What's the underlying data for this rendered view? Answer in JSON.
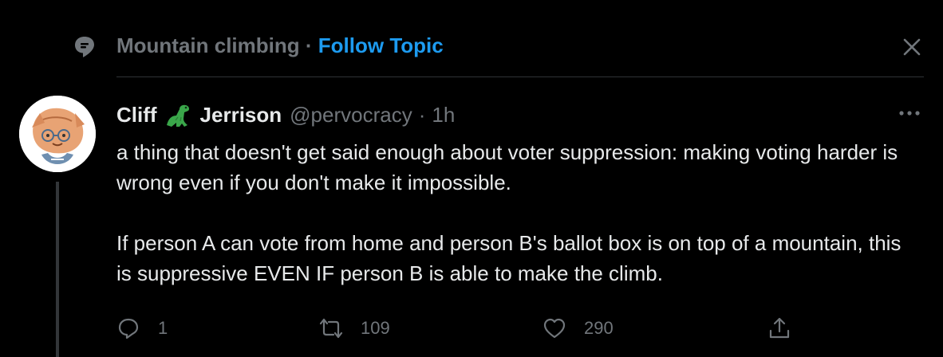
{
  "topic": {
    "name": "Mountain climbing",
    "separator": "·",
    "follow_label": "Follow Topic"
  },
  "tweet": {
    "author_first": "Cliff",
    "author_last": "Jerrison",
    "handle": "@pervocracy",
    "separator": "·",
    "time": "1h",
    "paragraphs": [
      "a thing that doesn't get said enough about voter suppression: making voting harder is wrong even if you don't make it impossible.",
      "If person A can vote from home and person B's ballot box is on top of a mountain, this is suppressive EVEN IF person B is able to make the climb."
    ],
    "reply_count": "1",
    "retweet_count": "109",
    "like_count": "290"
  },
  "icons": {
    "topic": "topic-icon",
    "close": "close-icon",
    "more": "more-icon",
    "reply": "reply-icon",
    "retweet": "retweet-icon",
    "like": "like-icon",
    "share": "share-icon",
    "dino": "dinosaur-emoji"
  },
  "colors": {
    "background": "#000000",
    "accent": "#1d9bf0",
    "muted": "#71767b",
    "text": "#e7e9ea"
  }
}
